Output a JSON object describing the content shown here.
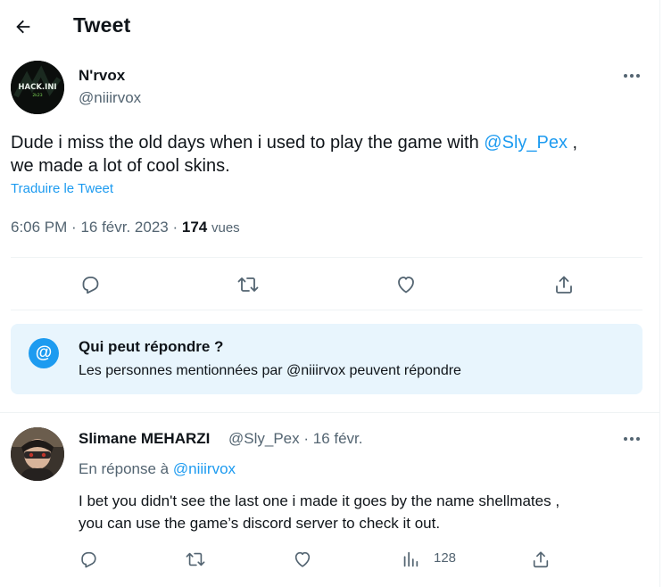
{
  "header": {
    "title": "Tweet"
  },
  "tweet": {
    "author_name": "N'rvox",
    "author_handle": "@niiirvox",
    "avatar_text": "HACK.INI",
    "avatar_subtext": "2k23",
    "text_before": "Dude i miss the old days when i used to play the game with ",
    "text_mention": "@Sly_Pex",
    "text_after": " ,\nwe made a lot of cool skins.",
    "translate_label": "Traduire le Tweet",
    "time": "6:06 PM",
    "date": "16 févr. 2023",
    "views_count": "174",
    "views_label": "vues"
  },
  "reply_restriction": {
    "title": "Qui peut répondre ?",
    "subtitle": "Les personnes mentionnées par @niiirvox peuvent répondre",
    "icon_glyph": "@"
  },
  "reply": {
    "author_name": "Slimane MEHARZI",
    "author_handle": "@Sly_Pex",
    "date": "16 févr.",
    "in_reply_prefix": "En réponse à ",
    "in_reply_mention": "@niiirvox",
    "text": "I bet you didn't see the last one i made it goes by the name shellmates ,\nyou can use the game’s discord server to check it out.",
    "views_count": "128"
  },
  "icons": {
    "back": "arrow-left-icon",
    "more": "more-dots-icon",
    "reply": "reply-icon",
    "retweet": "retweet-icon",
    "like": "like-icon",
    "share": "share-icon",
    "views": "analytics-icon"
  },
  "colors": {
    "accent": "#1d9bf0",
    "muted": "#536471",
    "text": "#0f1419",
    "divider": "#eff3f4",
    "restriction_bg": "#e8f5fd"
  }
}
